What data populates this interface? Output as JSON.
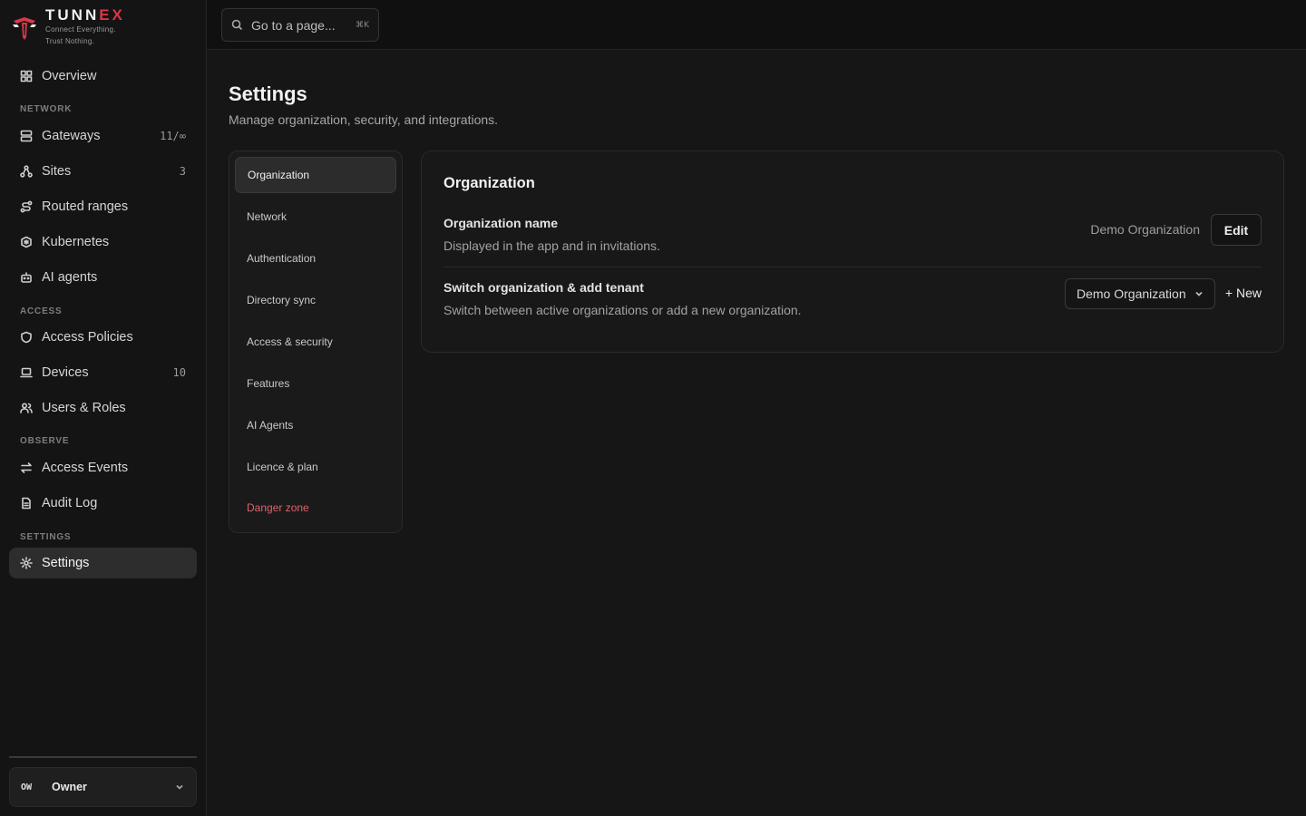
{
  "brand": {
    "name_main": "TUNN",
    "name_accent": "EX",
    "tagline_1": "Connect Everything.",
    "tagline_2": "Trust Nothing.",
    "accent_color": "#d8384a"
  },
  "sidebar": {
    "overview": {
      "label": "Overview",
      "icon": "grid-icon"
    },
    "sections": {
      "network": "NETWORK",
      "access": "ACCESS",
      "observe": "OBSERVE",
      "settings": "SETTINGS"
    },
    "items": {
      "gateways": {
        "label": "Gateways",
        "count": "11/∞",
        "icon": "server-icon"
      },
      "sites": {
        "label": "Sites",
        "count": "3",
        "icon": "sites-icon"
      },
      "routed_ranges": {
        "label": "Routed ranges",
        "icon": "route-icon"
      },
      "kubernetes": {
        "label": "Kubernetes",
        "icon": "kubernetes-icon"
      },
      "ai_agents": {
        "label": "AI agents",
        "icon": "bot-icon"
      },
      "access_policies": {
        "label": "Access Policies",
        "icon": "shield-icon"
      },
      "devices": {
        "label": "Devices",
        "count": "10",
        "icon": "laptop-icon"
      },
      "users_roles": {
        "label": "Users & Roles",
        "icon": "users-icon"
      },
      "access_events": {
        "label": "Access Events",
        "icon": "arrows-icon"
      },
      "audit_log": {
        "label": "Audit Log",
        "icon": "file-icon"
      },
      "settings": {
        "label": "Settings",
        "icon": "gear-icon"
      }
    },
    "user": {
      "initials": "OW",
      "name": "Owner"
    }
  },
  "search": {
    "placeholder": "Go to a page...",
    "shortcut": "⌘K"
  },
  "page": {
    "title": "Settings",
    "subtitle": "Manage organization, security, and integrations."
  },
  "subnav": [
    {
      "label": "Organization",
      "active": true
    },
    {
      "label": "Network"
    },
    {
      "label": "Authentication"
    },
    {
      "label": "Directory sync"
    },
    {
      "label": "Access & security"
    },
    {
      "label": "Features"
    },
    {
      "label": "AI Agents"
    },
    {
      "label": "Licence & plan"
    },
    {
      "label": "Danger zone",
      "danger": true
    }
  ],
  "panel": {
    "title": "Organization",
    "org_name": {
      "label": "Organization name",
      "description": "Displayed in the app and in invitations.",
      "value": "Demo Organization",
      "edit_label": "Edit"
    },
    "switch_org": {
      "label": "Switch organization & add tenant",
      "description": "Switch between active organizations or add a new organization.",
      "selected": "Demo Organization",
      "new_label": "+ New"
    }
  }
}
